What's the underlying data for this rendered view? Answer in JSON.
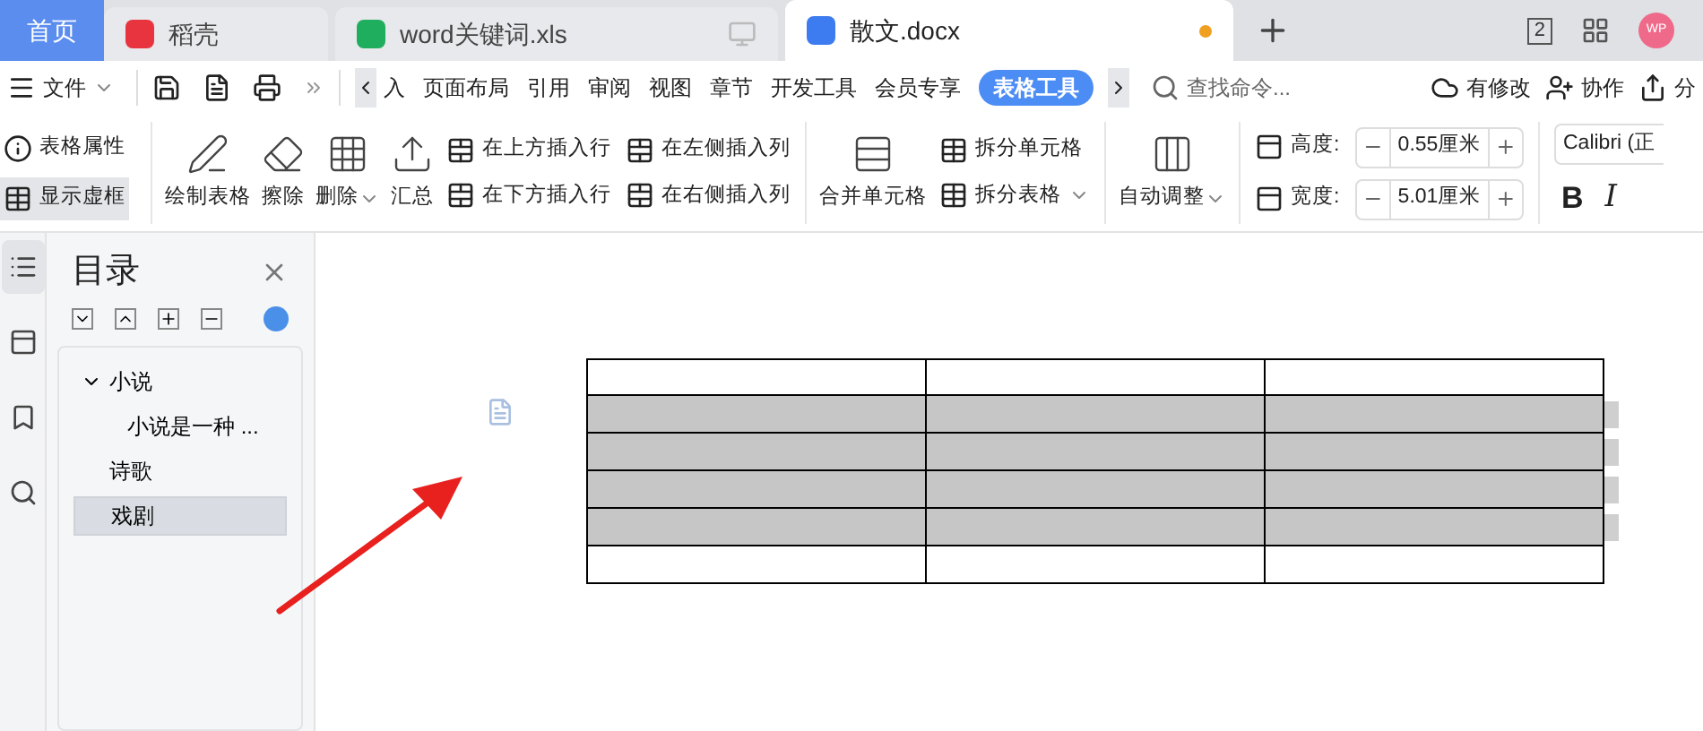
{
  "tabs": [
    {
      "kind": "home",
      "label": "首页",
      "selected": false
    },
    {
      "kind": "docer",
      "label": "稻壳",
      "selected": false
    },
    {
      "kind": "sheet",
      "label": "word关键词.xls",
      "selected": false
    },
    {
      "kind": "writer",
      "label": "散文.docx",
      "selected": true,
      "unsaved": true
    }
  ],
  "window_badge": "2",
  "avatar": "WP",
  "menu": {
    "file": "文件",
    "items": [
      {
        "label": "入",
        "selected": false
      },
      {
        "label": "页面布局",
        "selected": false
      },
      {
        "label": "引用",
        "selected": false
      },
      {
        "label": "审阅",
        "selected": false
      },
      {
        "label": "视图",
        "selected": false
      },
      {
        "label": "章节",
        "selected": false
      },
      {
        "label": "开发工具",
        "selected": false
      },
      {
        "label": "会员专享",
        "selected": false
      },
      {
        "label": "表格工具",
        "selected": true
      }
    ],
    "search": {
      "placeholder": "查找命令..."
    },
    "actions": [
      "有修改",
      "协作",
      "分"
    ]
  },
  "ribbon": [
    {
      "kind": "toggles",
      "items": [
        {
          "label": "表格属性",
          "selected": false
        },
        {
          "label": "显示虚框",
          "selected": true
        }
      ]
    },
    {
      "kind": "large",
      "label": "绘制表格",
      "dropdown": false
    },
    {
      "kind": "large",
      "label": "擦除",
      "dropdown": false
    },
    {
      "kind": "large",
      "label": "删除",
      "dropdown": true
    },
    {
      "kind": "large",
      "label": "汇总",
      "dropdown": false
    },
    {
      "kind": "pairs",
      "items": [
        "在上方插入行",
        "在下方插入行",
        "在左侧插入列",
        "在右侧插入列"
      ]
    },
    {
      "kind": "large",
      "label": "合并单元格",
      "dropdown": false
    },
    {
      "kind": "stack",
      "items": [
        {
          "label": "拆分单元格",
          "dropdown": false
        },
        {
          "label": "拆分表格",
          "dropdown": true
        }
      ]
    },
    {
      "kind": "large",
      "label": "自动调整",
      "dropdown": true
    },
    {
      "kind": "size",
      "fields": [
        {
          "label": "高度:",
          "value": "0.55厘米"
        },
        {
          "label": "宽度:",
          "value": "5.01厘米"
        }
      ]
    },
    {
      "kind": "font",
      "value": "Calibri (正",
      "styles": [
        "B",
        "I"
      ]
    }
  ],
  "side_strip": [
    {
      "kind": "outline",
      "selected": true
    },
    {
      "kind": "panes",
      "selected": false
    },
    {
      "kind": "bookmark",
      "selected": false
    },
    {
      "kind": "search",
      "selected": false
    }
  ],
  "toc": {
    "title": "目录",
    "items": [
      {
        "label": "小说",
        "expanded": true,
        "selected": false,
        "children": [
          {
            "label": "小说是一种 ...",
            "selected": false
          }
        ]
      },
      {
        "label": "诗歌",
        "selected": false
      },
      {
        "label": "戏剧",
        "selected": true
      }
    ]
  },
  "table": {
    "rows": [
      {
        "selected": false
      },
      {
        "selected": true
      },
      {
        "selected": true
      },
      {
        "selected": true
      },
      {
        "selected": true
      },
      {
        "selected": false
      }
    ]
  }
}
